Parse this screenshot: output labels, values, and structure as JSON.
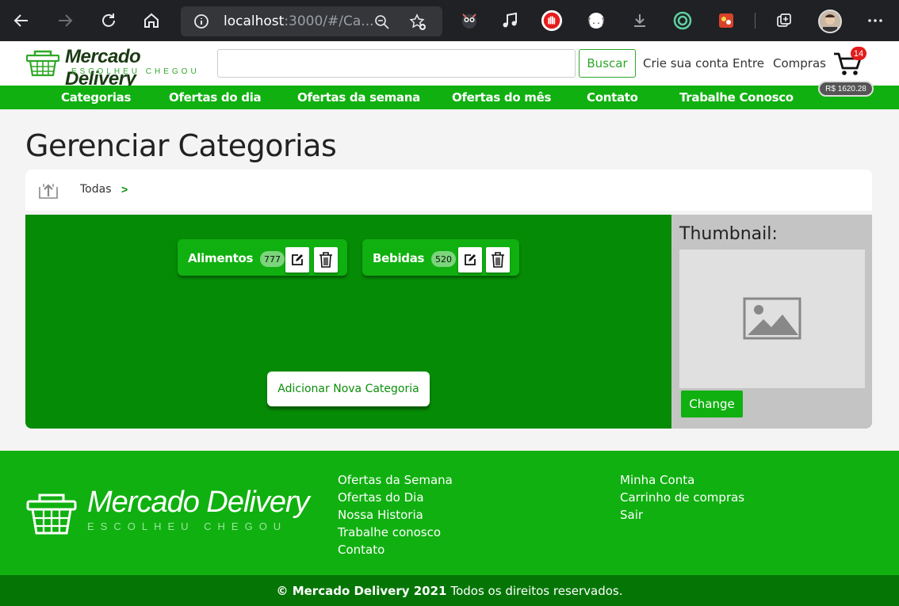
{
  "browser": {
    "url_host": "localhost",
    "url_rest": ":3000/#/Ca..."
  },
  "header": {
    "logo_title": "Mercado Delivery",
    "logo_tagline": "ESCOLHEU CHEGOU",
    "search_placeholder": "",
    "search_button": "Buscar",
    "links": [
      "Crie sua conta",
      "Entre",
      "Compras"
    ],
    "cart_count": "14",
    "cart_total": "R$ 1620.28"
  },
  "nav": {
    "items": [
      "Categorias",
      "Ofertas do dia",
      "Ofertas da semana",
      "Ofertas do mês",
      "Contato",
      "Trabalhe Conosco"
    ]
  },
  "main": {
    "title": "Gerenciar Categorias",
    "breadcrumb": {
      "root": "Todas",
      "separator": ">"
    },
    "categories": [
      {
        "name": "Alimentos",
        "count": "777"
      },
      {
        "name": "Bebidas",
        "count": "520"
      }
    ],
    "add_button": "Adicionar Nova Categoria",
    "thumbnail": {
      "title": "Thumbnail:",
      "change_button": "Change"
    }
  },
  "footer": {
    "logo_title": "Mercado Delivery",
    "logo_tagline": "ESCOLHEU CHEGOU",
    "col1": [
      "Ofertas da Semana",
      "Ofertas do Dia",
      "Nossa Historia",
      "Trabalhe conosco",
      "Contato"
    ],
    "col2": [
      "Minha Conta",
      "Carrinho de compras",
      "Sair"
    ],
    "copyright_bold": "© Mercado Delivery 2021",
    "copyright_text": "Todos os direitos reservados."
  },
  "colors": {
    "brand_green": "#10b010",
    "dark_green": "#068b06",
    "badge_red": "#e51c1c"
  }
}
